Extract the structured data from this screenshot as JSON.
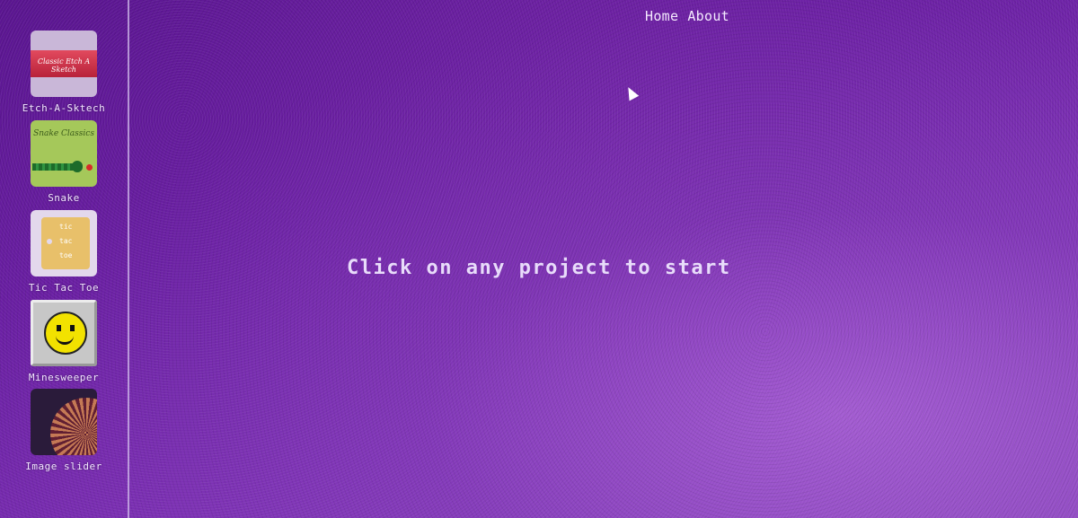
{
  "nav": {
    "home_label": "Home",
    "about_label": "About"
  },
  "main": {
    "message": "Click on any project to start"
  },
  "projects": [
    {
      "label": "Etch-A-Sktech",
      "thumb_text": "Classic Etch A Sketch"
    },
    {
      "label": "Snake",
      "thumb_text": "Snake Classics"
    },
    {
      "label": "Tic Tac Toe",
      "thumb_text": [
        "tic",
        "tac",
        "toe"
      ]
    },
    {
      "label": "Minesweeper"
    },
    {
      "label": "Image slider"
    }
  ],
  "colors": {
    "background": "#6a1fa3",
    "sidebar_border": "#d2beeb",
    "text": "#e8dcfa"
  }
}
